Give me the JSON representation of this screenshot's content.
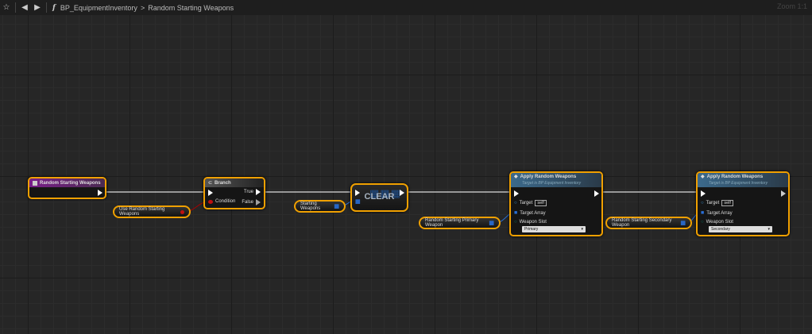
{
  "toolbar": {
    "function_glyph": "f",
    "breadcrumb": [
      "BP_EquipmentInventory",
      "Random Starting Weapons"
    ],
    "separator": ">",
    "zoom": "Zoom 1:1"
  },
  "nodes": {
    "event": {
      "title": "Random Starting Weapons"
    },
    "branch": {
      "title": "Branch",
      "condition": "Condition",
      "true": "True",
      "false": "False"
    },
    "use_var": {
      "label": "Use Random Starting Weapons"
    },
    "starting_var": {
      "label": "Starting Weapons"
    },
    "clear": {
      "title": "CLEAR"
    },
    "primary_var": {
      "label": "Random Starting Primary Weapon"
    },
    "apply1": {
      "title": "Apply Random Weapons",
      "subtitle": "Target is BP Equipment Inventory",
      "target": "Target",
      "self": "self",
      "target_array": "Target Array",
      "weapon_slot": "Weapon Slot",
      "slot_value": "Primary"
    },
    "secondary_var": {
      "label": "Random Starting Secondary Weapon"
    },
    "apply2": {
      "title": "Apply Random Weapons",
      "subtitle": "Target is BP Equipment Inventory",
      "target": "Target",
      "self": "self",
      "target_array": "Target Array",
      "weapon_slot": "Weapon Slot",
      "slot_value": "Secondary"
    }
  },
  "colors": {
    "accent": "#f0a000",
    "event_header": "#7a1f8a",
    "function_header": "#3c6a8c",
    "bool_pin": "#c01010",
    "array_pin": "#2a6fd8"
  }
}
